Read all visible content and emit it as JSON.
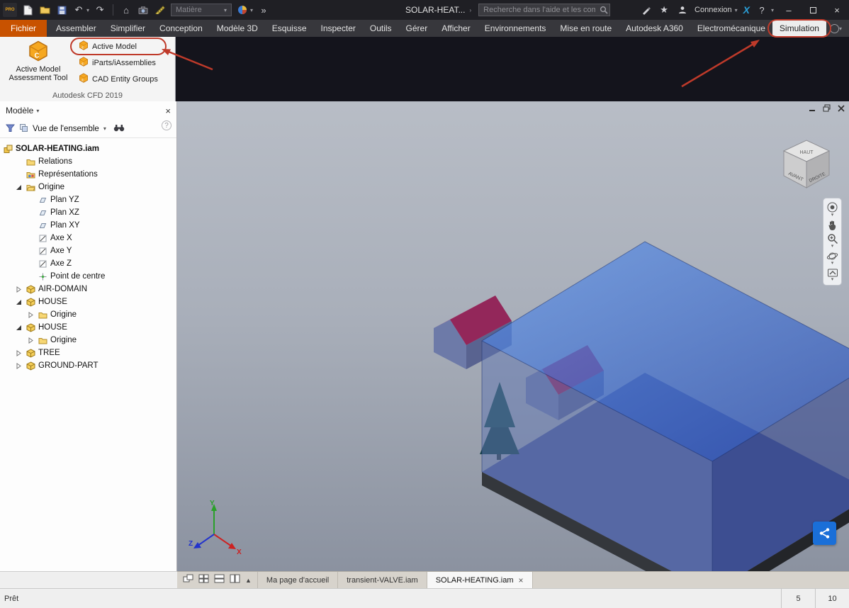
{
  "colors": {
    "annotation": "#bf3a2a",
    "accent": "#1a6fd8",
    "fichier_tab": "#c85200"
  },
  "icons": {
    "caret": "▾",
    "home": "⌂",
    "undo": "↶",
    "redo": "↷",
    "overflow": "»",
    "star": "★",
    "close": "×",
    "help": "?",
    "expand_up": "▲",
    "breadcrumb_arrow": "›"
  },
  "titlebar": {
    "app_badge": "PRO",
    "doc_title": "SOLAR-HEAT...",
    "material_dropdown": "Matière",
    "search_placeholder": "Recherche dans l'aide et les com",
    "connexion_label": "Connexion"
  },
  "ribbon": {
    "tabs": [
      "Fichier",
      "Assembler",
      "Simplifier",
      "Conception",
      "Modèle 3D",
      "Esquisse",
      "Inspecter",
      "Outils",
      "Gérer",
      "Afficher",
      "Environnements",
      "Mise en route",
      "Autodesk A360",
      "Electromécanique",
      "Simulation"
    ],
    "file_tab": "Fichier",
    "active_tab": "Simulation",
    "panel": {
      "big_button_label": "Active Model Assessment Tool",
      "items": [
        "Active Model",
        "iParts/iAssemblies",
        "CAD Entity Groups"
      ],
      "annotated_item": "Active Model",
      "footer": "Autodesk CFD 2019"
    }
  },
  "browser": {
    "title": "Modèle",
    "view_filter": "Vue de l'ensemble",
    "tree": [
      {
        "label": "SOLAR-HEATING.iam",
        "icon": "assembly",
        "level": 0,
        "exp": "",
        "bold": true
      },
      {
        "label": "Relations",
        "icon": "folder",
        "level": 1,
        "exp": ""
      },
      {
        "label": "Représentations",
        "icon": "representations",
        "level": 1,
        "exp": ""
      },
      {
        "label": "Origine",
        "icon": "folder-open",
        "level": 1,
        "exp": "open"
      },
      {
        "label": "Plan YZ",
        "icon": "plane",
        "level": 2,
        "exp": ""
      },
      {
        "label": "Plan XZ",
        "icon": "plane",
        "level": 2,
        "exp": ""
      },
      {
        "label": "Plan XY",
        "icon": "plane",
        "level": 2,
        "exp": ""
      },
      {
        "label": "Axe X",
        "icon": "axis",
        "level": 2,
        "exp": ""
      },
      {
        "label": "Axe Y",
        "icon": "axis",
        "level": 2,
        "exp": ""
      },
      {
        "label": "Axe Z",
        "icon": "axis",
        "level": 2,
        "exp": ""
      },
      {
        "label": "Point de centre",
        "icon": "centerpoint",
        "level": 2,
        "exp": ""
      },
      {
        "label": "AIR-DOMAIN",
        "icon": "part",
        "level": 1,
        "exp": "closed"
      },
      {
        "label": "HOUSE",
        "icon": "part",
        "level": 1,
        "exp": "open"
      },
      {
        "label": "Origine",
        "icon": "folder",
        "level": 2,
        "exp": "closed"
      },
      {
        "label": "HOUSE",
        "icon": "part",
        "level": 1,
        "exp": "open"
      },
      {
        "label": "Origine",
        "icon": "folder",
        "level": 2,
        "exp": "closed"
      },
      {
        "label": "TREE",
        "icon": "part",
        "level": 1,
        "exp": "closed"
      },
      {
        "label": "GROUND-PART",
        "icon": "part",
        "level": 1,
        "exp": "closed"
      }
    ]
  },
  "viewport": {
    "viewcube": {
      "top": "HAUT",
      "front": "AVANT",
      "right": "DROITE"
    },
    "triad": {
      "x": "X",
      "y": "Y",
      "z": "Z"
    }
  },
  "doc_tabs": {
    "tabs": [
      "Ma page d'accueil",
      "transient-VALVE.iam",
      "SOLAR-HEATING.iam"
    ],
    "active": "SOLAR-HEATING.iam"
  },
  "statusbar": {
    "message": "Prêt",
    "cell1": "5",
    "cell2": "10"
  }
}
